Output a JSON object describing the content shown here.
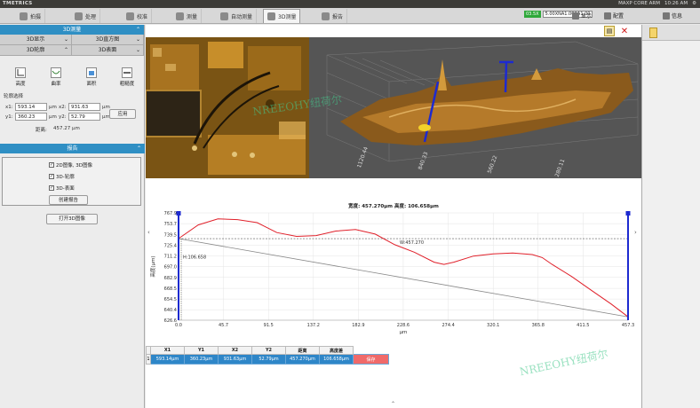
{
  "titlebar": {
    "app": "TMETRICS",
    "indicators": [
      "MAXP CORE ARM",
      "10:26 AM"
    ]
  },
  "tabs": [
    {
      "label": "拍摄",
      "icon": "camera-icon"
    },
    {
      "label": "处理",
      "icon": "process-icon"
    },
    {
      "label": "校准",
      "icon": "calibrate-icon"
    },
    {
      "label": "测量",
      "icon": "measure-icon"
    },
    {
      "label": "自动测量",
      "icon": "auto-measure-icon"
    },
    {
      "label": "3D测量",
      "icon": "3d-measure-icon"
    },
    {
      "label": "报告",
      "icon": "report-icon"
    }
  ],
  "status": {
    "green": "03.5X",
    "objective": "5.00XNA1.00CA1.00",
    "display": "显示",
    "config": "配置",
    "info": "信息"
  },
  "leftpanel": {
    "section1": "3D测量",
    "sub1": [
      "3D显示",
      "3D直方图"
    ],
    "sub2": [
      "3D轮廓",
      "3D表面"
    ],
    "tools": [
      {
        "label": "高度",
        "icon": "height-icon"
      },
      {
        "label": "曲率",
        "icon": "curvature-icon"
      },
      {
        "label": "面积",
        "icon": "area-icon"
      },
      {
        "label": "粗糙度",
        "icon": "roughness-icon"
      }
    ],
    "profile_select": "轮廓选择",
    "x1_label": "x1:",
    "x1": "593.14",
    "x2_label": "x2:",
    "x2": "931.63",
    "y1_label": "y1:",
    "y1": "360.23",
    "y2_label": "y2:",
    "y2": "52.79",
    "unit": "μm",
    "apply": "应用",
    "distance_label": "距离:",
    "distance": "457.27 μm",
    "section2": "报告",
    "checks": [
      "2D图像, 3D图像",
      "3D-轮廓",
      "3D-表面"
    ],
    "create_report": "创建报告",
    "open_3d": "打开3D图像"
  },
  "img3d_axis": [
    "1120.44",
    "840.33",
    "560.22",
    "280.11"
  ],
  "profile_header": "宽度:  457.270μm  高度:  106.658μm",
  "chart_data": {
    "type": "line",
    "xlabel": "μm",
    "ylabel": "高度(μm)",
    "xticks": [
      0.0,
      45.7,
      91.5,
      137.2,
      182.9,
      228.6,
      274.4,
      320.1,
      365.8,
      411.5,
      457.3
    ],
    "yticks": [
      626.6,
      640.4,
      654.5,
      668.5,
      682.9,
      697.0,
      711.2,
      725.4,
      739.5,
      753.7,
      767.9
    ],
    "xlim": [
      0,
      457.3
    ],
    "ylim": [
      626.6,
      767.9
    ],
    "profile": {
      "x": [
        0,
        20,
        40,
        60,
        80,
        100,
        120,
        140,
        160,
        180,
        200,
        220,
        240,
        260,
        270,
        280,
        300,
        320,
        340,
        360,
        370,
        380,
        400,
        420,
        440,
        457.3
      ],
      "y": [
        734,
        752,
        760,
        759,
        755,
        742,
        737,
        738,
        744,
        746,
        740,
        726,
        716,
        703,
        700,
        703,
        711,
        714,
        715,
        713,
        709,
        700,
        684,
        666,
        648,
        631
      ]
    },
    "baseline": {
      "x": [
        0,
        457.3
      ],
      "y": [
        734,
        631
      ]
    },
    "reference_y": 734,
    "annotations": {
      "width": "W:457.270",
      "height": "H:106.658"
    }
  },
  "table": {
    "headers": [
      "X1",
      "Y1",
      "X2",
      "Y2",
      "距离",
      "高度差"
    ],
    "row_num": "1",
    "values": [
      "593.14μm",
      "360.23μm",
      "931.63μm",
      "52.79μm",
      "457.270μm",
      "106.658μm"
    ],
    "save": "保存"
  },
  "watermark": "NREEOHY纽荷尔",
  "colors": {
    "accent": "#2f8fc4",
    "curve": "#e0202a",
    "cursor": "#1d2ad0",
    "save": "#f06a6a"
  }
}
